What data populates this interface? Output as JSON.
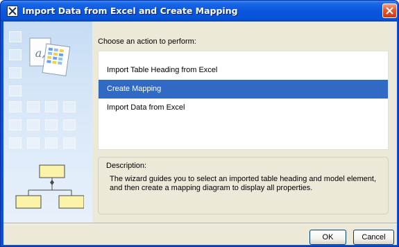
{
  "window": {
    "title": "Import Data from Excel and Create Mapping",
    "title_icon": "wizard-icon",
    "close_icon": "close-icon"
  },
  "side_panel": {
    "illustration": "excel-import-illustration",
    "diagram": "mapping-diagram-illustration",
    "glyph_text": "a,"
  },
  "main": {
    "prompt": "Choose an action to perform:",
    "actions": [
      {
        "label": "Import Table Heading from Excel",
        "selected": false
      },
      {
        "label": "Create Mapping",
        "selected": true
      },
      {
        "label": "Import Data from Excel",
        "selected": false
      }
    ],
    "description": {
      "label": "Description:",
      "text": "The wizard guides you to select an imported table heading and model element, and then create a mapping diagram to display all properties."
    }
  },
  "footer": {
    "ok_label": "OK",
    "cancel_label": "Cancel"
  },
  "colors": {
    "titlebar": "#0a56dc",
    "selection": "#316ac5",
    "dialog_bg": "#ece9d8",
    "close_button": "#e25a2e"
  }
}
